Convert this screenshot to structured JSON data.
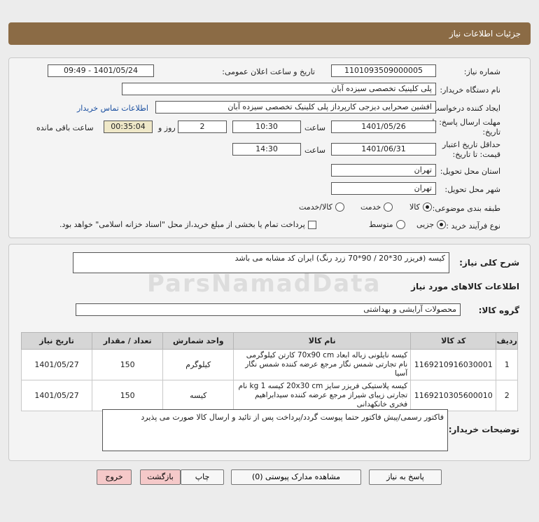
{
  "header": {
    "title": "جزئیات اطلاعات نیاز"
  },
  "info": {
    "need_number_label": "شماره نیاز:",
    "need_number": "1101093509000005",
    "announce_label": "تاریخ و ساعت اعلان عمومی:",
    "announce_value": "1401/05/24 - 09:49",
    "buyer_org_label": "نام دستگاه خریدار:",
    "buyer_org": "پلی کلینیک تخصصی سیزده آبان",
    "creator_label": "ایجاد کننده درخواست:",
    "creator": "افشین  صحرایی دیزجی کارپرداز پلی کلینیک تخصصی سیزده آبان",
    "contact_link": "اطلاعات تماس خریدار",
    "deadline_label_1": "مهلت ارسال پاسخ: تا",
    "deadline_label_2": "تاریخ:",
    "deadline_date": "1401/05/26",
    "time_label": "ساعت",
    "deadline_time": "10:30",
    "days_value": "2",
    "days_label": "روز و",
    "remaining_time": "00:35:04",
    "remaining_label": "ساعت باقی مانده",
    "validity_label_1": "حداقل تاریخ اعتبار",
    "validity_label_2": "قیمت: تا تاریخ:",
    "validity_date": "1401/06/31",
    "validity_time_label": "ساعت",
    "validity_time": "14:30",
    "province_label": "استان محل تحویل:",
    "province": "تهران",
    "city_label": "شهر محل تحویل:",
    "city": "تهران",
    "category_label": "طبقه بندی موضوعی:",
    "category_options": [
      "کالا",
      "خدمت",
      "کالا/خدمت"
    ],
    "category_selected": "کالا",
    "process_label": "نوع فرآیند خرید :",
    "process_options": [
      "جزیی",
      "متوسط"
    ],
    "process_selected": "جزیی",
    "payment_note": "پرداخت تمام یا بخشی از مبلغ خرید،از محل \"اسناد خزانه اسلامی\" خواهد بود."
  },
  "description": {
    "label": "شرح کلی نیاز:",
    "value": "کیسه (فریزر 30*20 / 90*70 زرد رنگ) ایران کد مشابه می باشد"
  },
  "goods": {
    "section_title": "اطلاعات کالاهای مورد نیاز",
    "group_label": "گروه کالا:",
    "group_value": "محصولات آرایشی و بهداشتی",
    "columns": [
      "ردیف",
      "کد کالا",
      "نام کالا",
      "واحد شمارش",
      "تعداد / مقدار",
      "تاریخ نیاز"
    ],
    "rows": [
      {
        "index": "1",
        "code": "1169210916030001",
        "name": "کیسه نایلونی زباله ابعاد 70x90 cm کارتن کیلوگرمی نام تجارتی شمس نگار مرجع عرضه کننده شمس نگار آسیا",
        "unit": "کیلوگرم",
        "qty": "150",
        "date": "1401/05/27"
      },
      {
        "index": "2",
        "code": "1169210305600010",
        "name": "کیسه پلاستیکی فریزر سایز 20x30 cm کیسه 1 kg نام تجارتی زیبای شیراز مرجع عرضه کننده سیدابراهیم فخری خانکهدانی",
        "unit": "کیسه",
        "qty": "150",
        "date": "1401/05/27"
      }
    ]
  },
  "buyer_notes": {
    "label": "توضیحات خریدار:",
    "value": "فاکتور رسمی/پیش فاکتور حتما پیوست گردد/پرداخت پس از تائید و ارسال کالا صورت می پذیرد"
  },
  "buttons": {
    "reply": "پاسخ به نیاز",
    "docs": "مشاهده مدارک پیوستی (0)",
    "print": "چاپ",
    "back": "بازگشت",
    "exit": "خروج"
  },
  "watermark": "ParsNamadData"
}
